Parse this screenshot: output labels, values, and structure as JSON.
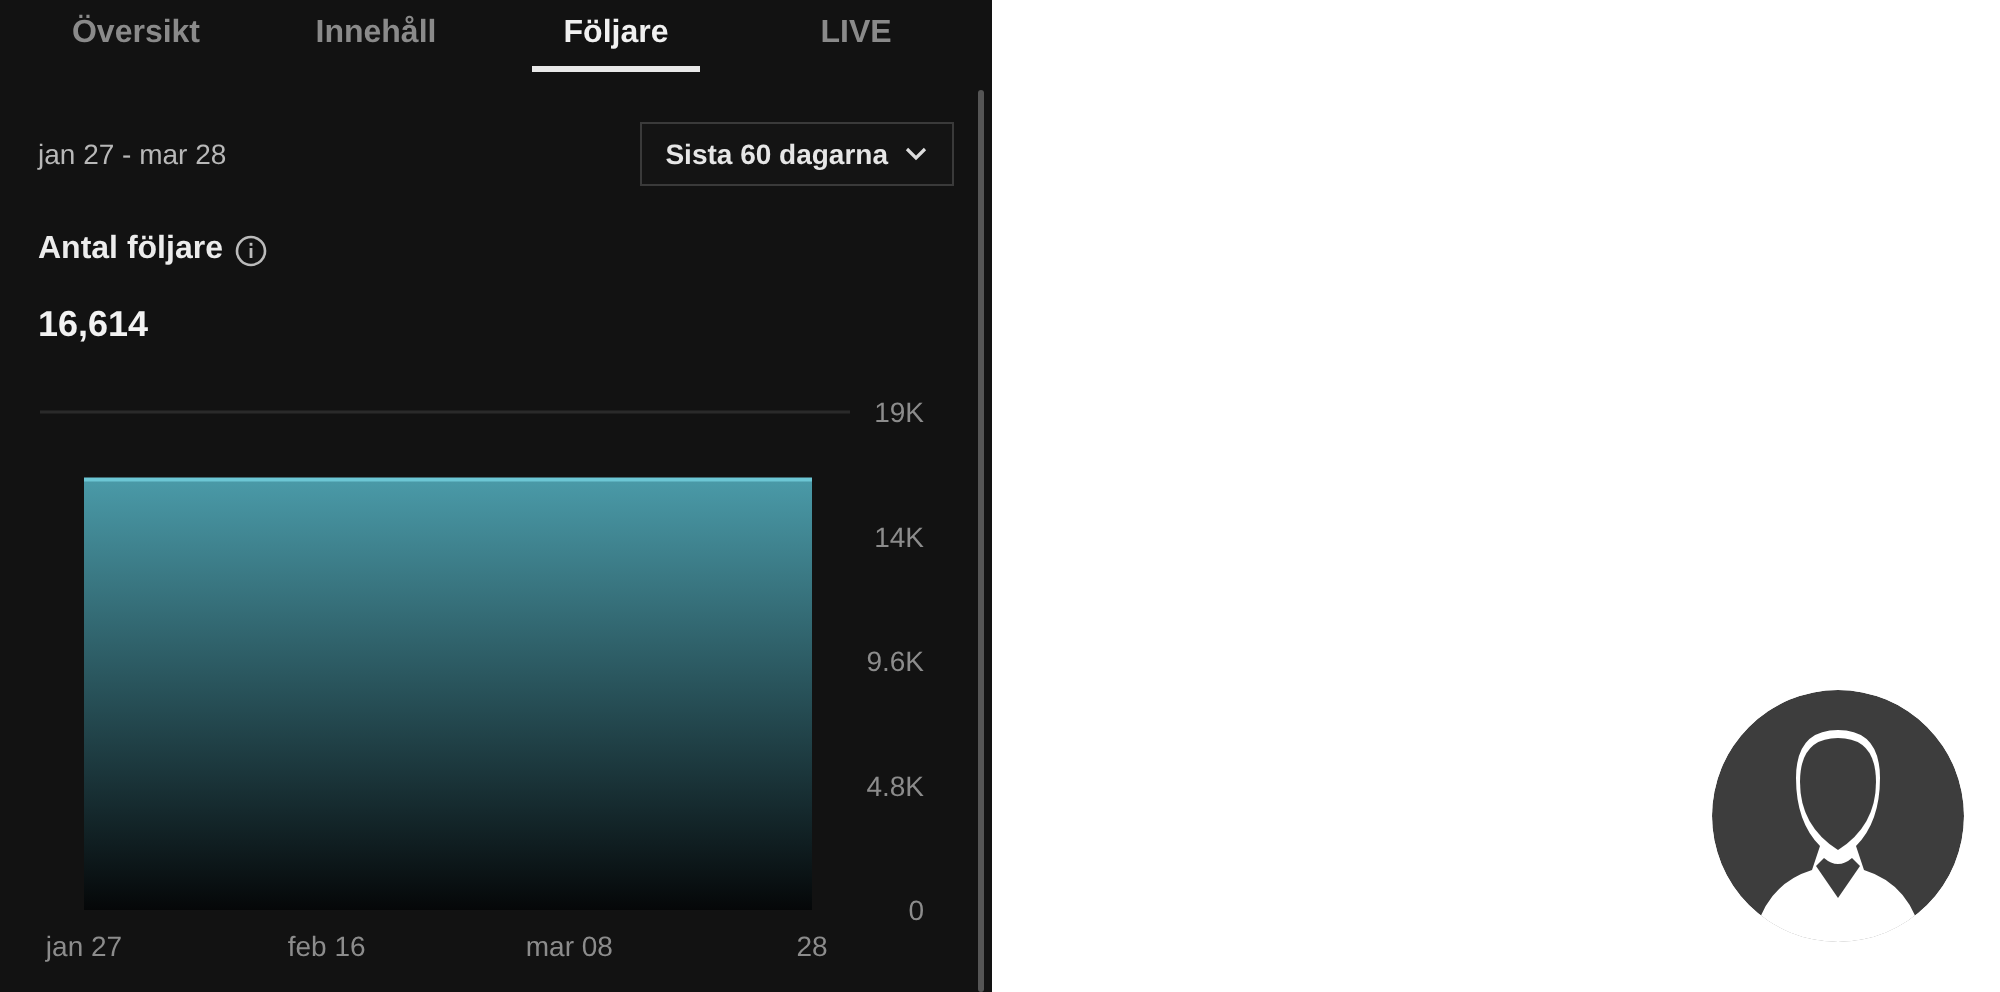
{
  "tabs": [
    {
      "label": "Översikt",
      "selected": false
    },
    {
      "label": "Innehåll",
      "selected": false
    },
    {
      "label": "Följare",
      "selected": true
    },
    {
      "label": "LIVE",
      "selected": false
    }
  ],
  "date_range": "jan 27 - mar 28",
  "period_dropdown": {
    "value": "Sista 60 dagarna"
  },
  "metric": {
    "title": "Antal följare",
    "value": "16,614"
  },
  "chart": {
    "chart_data": {
      "type": "area",
      "categories": [
        "jan 27",
        "feb 16",
        "mar 08",
        "28"
      ],
      "series": [
        {
          "color": "#4a9aa8",
          "values": [
            16600,
            16600,
            16600,
            16600
          ]
        }
      ],
      "ylim": [
        0,
        19200
      ],
      "yticks": [
        {
          "value": 0,
          "label": "0"
        },
        {
          "value": 4800,
          "label": "4.8K"
        },
        {
          "value": 9600,
          "label": "9.6K"
        },
        {
          "value": 14400,
          "label": "14K"
        },
        {
          "value": 19200,
          "label": "19K"
        }
      ]
    }
  }
}
